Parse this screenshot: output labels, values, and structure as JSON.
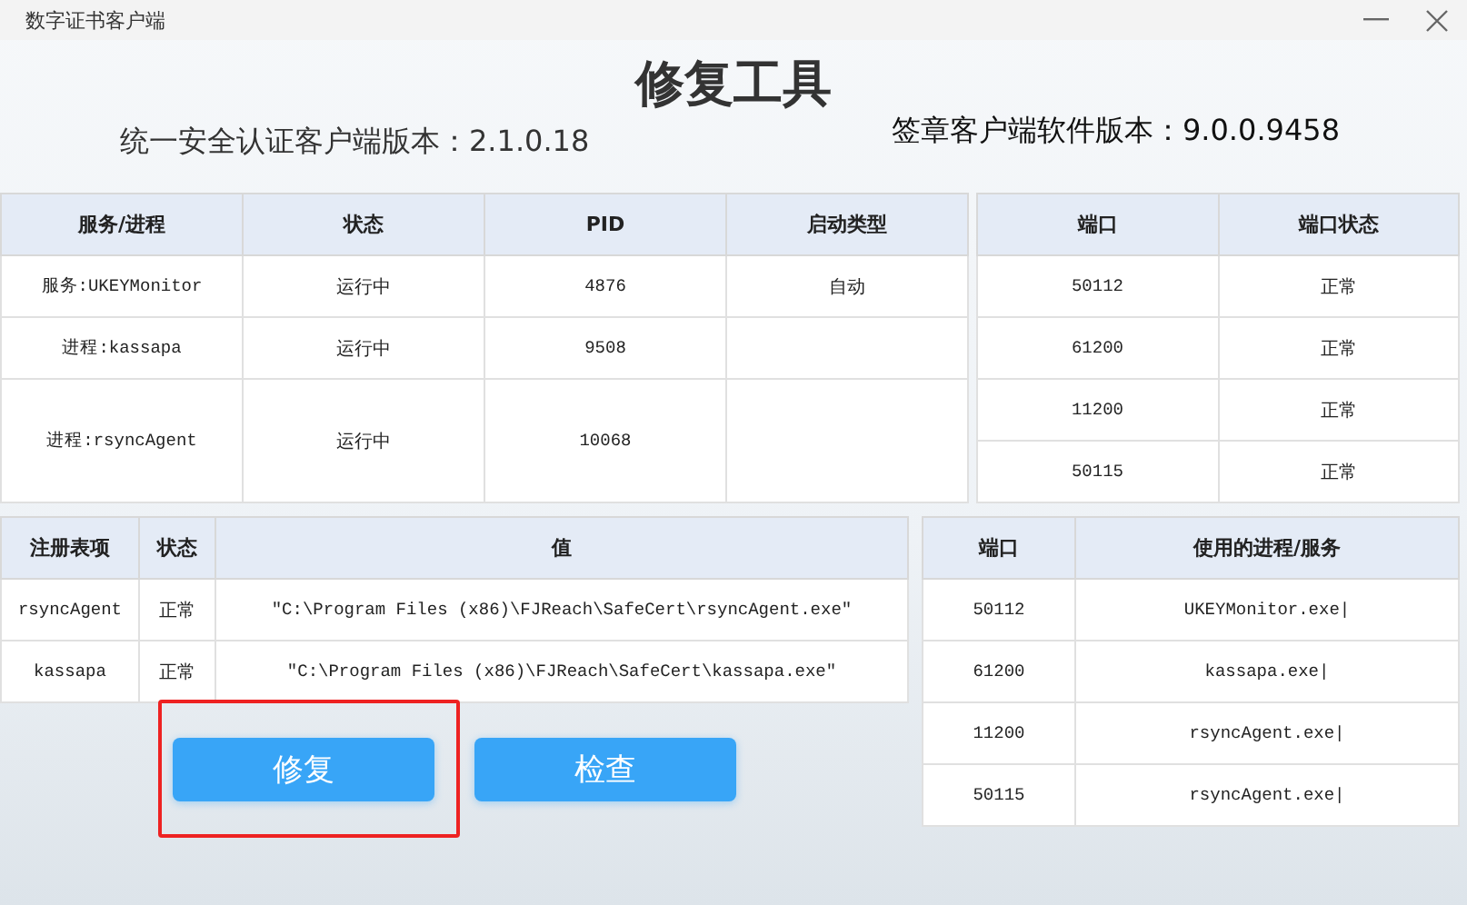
{
  "window": {
    "title": "数字证书客户端"
  },
  "header": {
    "title": "修复工具",
    "left_version": "统一安全认证客户端版本：2.1.0.18",
    "right_version": "签章客户端软件版本：9.0.0.9458"
  },
  "services": {
    "columns": [
      "服务/进程",
      "状态",
      "PID",
      "启动类型"
    ],
    "rows": [
      {
        "cells": [
          "服务:UKEYMonitor",
          "运行中",
          "4876",
          "自动"
        ],
        "tall": false
      },
      {
        "cells": [
          "进程:kassapa",
          "运行中",
          "9508",
          ""
        ],
        "tall": false
      },
      {
        "cells": [
          "进程:rsyncAgent",
          "运行中",
          "10068",
          ""
        ],
        "tall": true
      }
    ]
  },
  "port_status": {
    "columns": [
      "端口",
      "端口状态"
    ],
    "rows": [
      [
        "50112",
        "正常"
      ],
      [
        "61200",
        "正常"
      ],
      [
        "11200",
        "正常"
      ],
      [
        "50115",
        "正常"
      ]
    ]
  },
  "registry": {
    "columns": [
      "注册表项",
      "状态",
      "值"
    ],
    "rows": [
      [
        "rsyncAgent",
        "正常",
        "\"C:\\Program Files (x86)\\FJReach\\SafeCert\\rsyncAgent.exe\""
      ],
      [
        "kassapa",
        "正常",
        "\"C:\\Program Files (x86)\\FJReach\\SafeCert\\kassapa.exe\""
      ]
    ]
  },
  "port_usage": {
    "columns": [
      "端口",
      "使用的进程/服务"
    ],
    "rows": [
      [
        "50112",
        "UKEYMonitor.exe|"
      ],
      [
        "61200",
        "kassapa.exe|"
      ],
      [
        "11200",
        "rsyncAgent.exe|"
      ],
      [
        "50115",
        "rsyncAgent.exe|"
      ]
    ]
  },
  "buttons": [
    {
      "label": "修复",
      "highlighted": true
    },
    {
      "label": "检查",
      "highlighted": false
    }
  ]
}
